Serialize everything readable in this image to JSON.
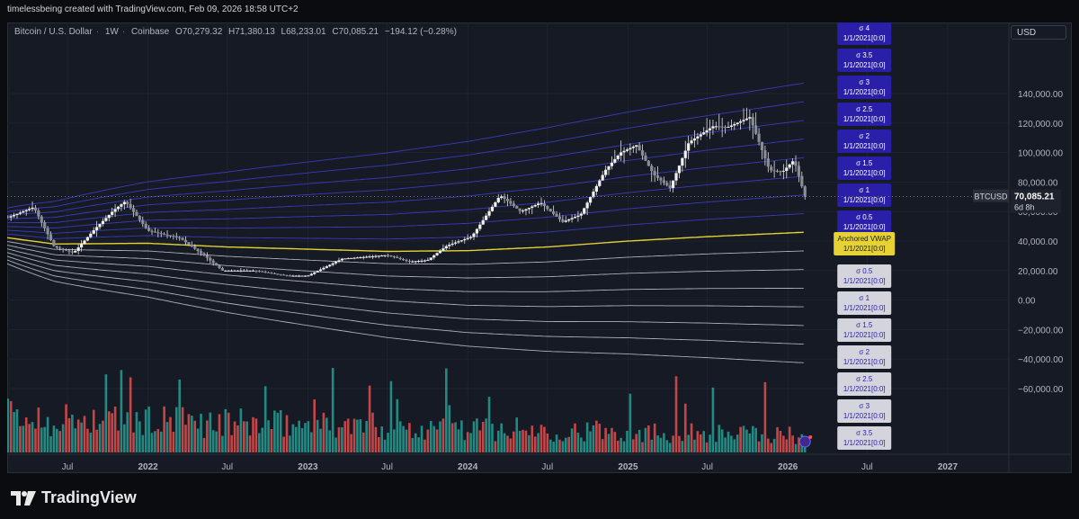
{
  "credit": "timelessbeing created with TradingView.com, Feb 09, 2026 18:58 UTC+2",
  "legend": {
    "symbol": "Bitcoin / U.S. Dollar",
    "interval": "1W",
    "exchange": "Coinbase",
    "open": "O70,279.32",
    "high": "H71,380.13",
    "low": "L68,233.01",
    "close": "C70,085.21",
    "change": "−194.12 (−0.28%)"
  },
  "currency_button": "USD",
  "brand": "TradingView",
  "colors": {
    "background": "#161a25",
    "upper_band": "#3b3fc9",
    "upper_label_bg": "#2a1fa8",
    "lower_band": "#c7c9d1",
    "lower_label_bg": "#d4d5dc",
    "vwap": "#e6d233",
    "volume_up": "#26a69a",
    "volume_down": "#ef5350",
    "candle": "#e0e0e0"
  },
  "chart_data": {
    "type": "line",
    "title": "Bitcoin / U.S. Dollar",
    "y_ticks": [
      "140,000.00",
      "120,000.00",
      "100,000.00",
      "80,000.00",
      "60,000.00",
      "40,000.00",
      "20,000.00",
      "0.00",
      "−20,000.00",
      "−40,000.00",
      "−60,000.00"
    ],
    "y_tick_values": [
      140000,
      120000,
      100000,
      80000,
      60000,
      40000,
      20000,
      0,
      -20000,
      -40000,
      -60000
    ],
    "x_ticks": [
      "Jul",
      "2022",
      "Jul",
      "2023",
      "Jul",
      "2024",
      "Jul",
      "2025",
      "Jul",
      "2026",
      "Jul",
      "2027"
    ],
    "x_tick_dates": [
      "2021-07-01",
      "2022-01-01",
      "2022-07-01",
      "2023-01-01",
      "2023-07-01",
      "2024-01-01",
      "2024-07-01",
      "2025-01-01",
      "2025-07-01",
      "2026-01-01",
      "2026-07-01",
      "2027-01-01"
    ],
    "ylim": [
      -76000,
      154000
    ],
    "price_label": {
      "symbol": "BTCUSD",
      "value": "70,085.21",
      "countdown": "6d 8h"
    },
    "price_series": {
      "name": "BTCUSD",
      "x": [
        "2021-01-01",
        "2021-02-15",
        "2021-04-15",
        "2021-06-01",
        "2021-07-15",
        "2021-09-01",
        "2021-10-15",
        "2021-11-10",
        "2022-01-01",
        "2022-03-15",
        "2022-05-10",
        "2022-06-20",
        "2022-09-01",
        "2022-11-15",
        "2023-01-01",
        "2023-03-20",
        "2023-05-01",
        "2023-07-01",
        "2023-08-20",
        "2023-10-01",
        "2023-11-15",
        "2024-01-10",
        "2024-03-15",
        "2024-05-01",
        "2024-06-15",
        "2024-08-05",
        "2024-09-15",
        "2024-11-10",
        "2024-12-15",
        "2025-01-20",
        "2025-03-01",
        "2025-04-07",
        "2025-05-20",
        "2025-07-15",
        "2025-08-15",
        "2025-10-06",
        "2025-11-20",
        "2025-12-20",
        "2026-01-15",
        "2026-02-09"
      ],
      "values": [
        60000,
        56000,
        63000,
        36000,
        32000,
        48000,
        61000,
        67000,
        47000,
        42000,
        30000,
        20000,
        20000,
        16500,
        16500,
        28000,
        29000,
        30500,
        26000,
        27000,
        37000,
        43000,
        71000,
        60000,
        66000,
        53000,
        58000,
        88000,
        100000,
        105000,
        85000,
        76000,
        107000,
        118000,
        117000,
        124000,
        88000,
        87000,
        95000,
        70085
      ]
    },
    "anchored_vwap": {
      "label": "Anchored VWAP",
      "anchor": "1/1/2021[0:0]",
      "x": [
        "2021-01-01",
        "2021-06-01",
        "2022-01-01",
        "2022-07-01",
        "2023-01-01",
        "2023-07-01",
        "2024-01-01",
        "2024-07-01",
        "2025-01-01",
        "2025-07-01",
        "2026-02-09"
      ],
      "values": [
        44000,
        38000,
        38500,
        36000,
        34500,
        33000,
        33500,
        36000,
        40000,
        43000,
        46000
      ]
    },
    "band_labels": {
      "upper": [
        {
          "name": "σ 4",
          "anchor": "1/1/2021[0:0]"
        },
        {
          "name": "σ 3.5",
          "anchor": "1/1/2021[0:0]"
        },
        {
          "name": "σ 3",
          "anchor": "1/1/2021[0:0]"
        },
        {
          "name": "σ 2.5",
          "anchor": "1/1/2021[0:0]"
        },
        {
          "name": "σ 2",
          "anchor": "1/1/2021[0:0]"
        },
        {
          "name": "σ 1.5",
          "anchor": "1/1/2021[0:0]"
        },
        {
          "name": "σ 1",
          "anchor": "1/1/2021[0:0]"
        },
        {
          "name": "σ 0.5",
          "anchor": "1/1/2021[0:0]"
        }
      ],
      "lower": [
        {
          "name": "σ 0.5",
          "anchor": "1/1/2021[0:0]"
        },
        {
          "name": "σ 1",
          "anchor": "1/1/2021[0:0]"
        },
        {
          "name": "σ 1.5",
          "anchor": "1/1/2021[0:0]"
        },
        {
          "name": "σ 2",
          "anchor": "1/1/2021[0:0]"
        },
        {
          "name": "σ 2.5",
          "anchor": "1/1/2021[0:0]"
        },
        {
          "name": "σ 3",
          "anchor": "1/1/2021[0:0]"
        },
        {
          "name": "σ 3.5",
          "anchor": "1/1/2021[0:0]"
        }
      ]
    },
    "sigma_levels": [
      0.5,
      1,
      1.5,
      2,
      2.5,
      3,
      3.5,
      4
    ],
    "sigma_step_end": 11000
  }
}
